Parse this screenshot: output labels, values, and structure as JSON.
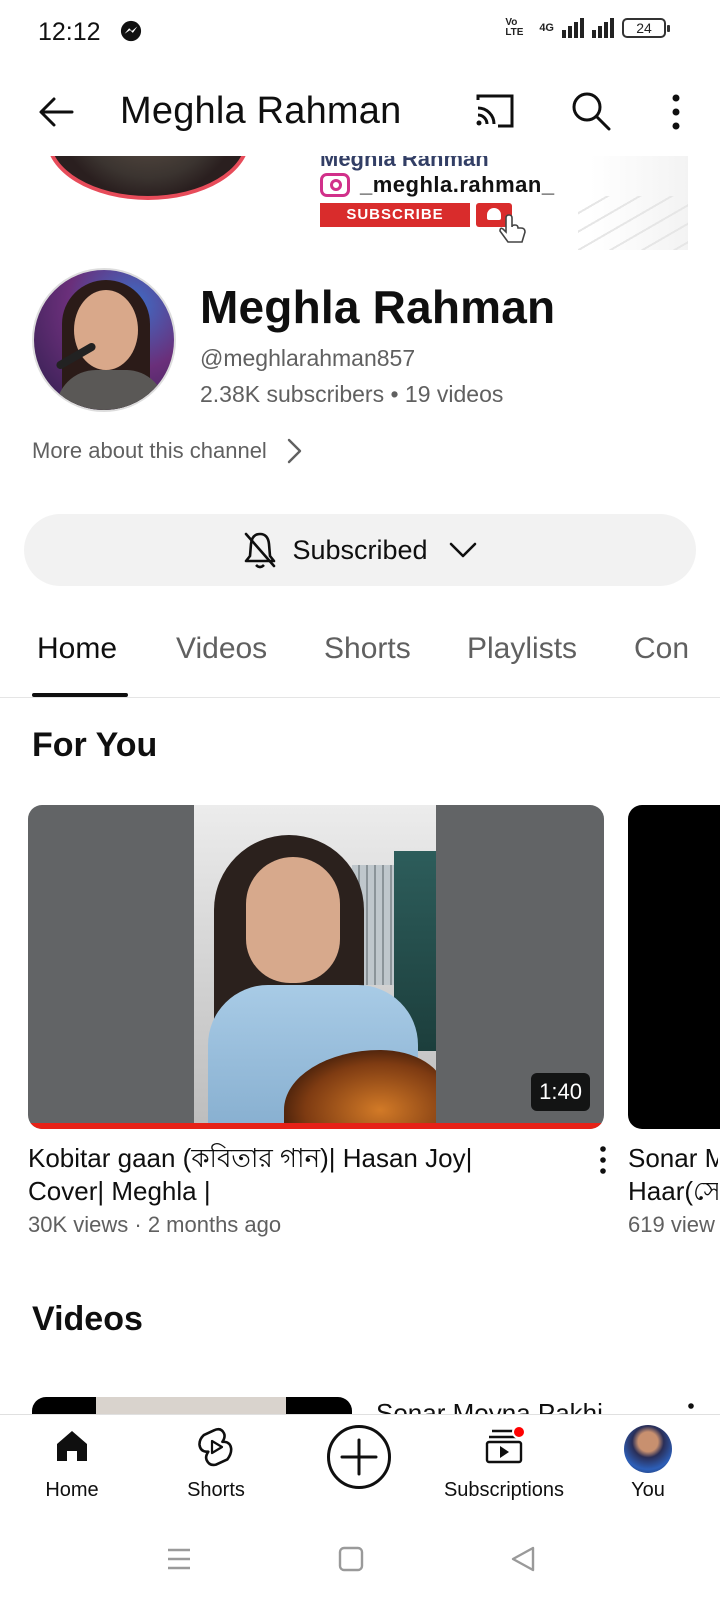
{
  "status_bar": {
    "time": "12:12",
    "network_type": "4G",
    "volte": "Vo LTE",
    "battery": "24"
  },
  "header": {
    "title": "Meghla Rahman"
  },
  "banner": {
    "line1": "Meghla Rahman",
    "instagram_handle": "_meghla.rahman_",
    "subscribe_label": "SUBSCRIBE"
  },
  "channel": {
    "name": "Meghla Rahman",
    "handle": "@meghlarahman857",
    "stats": "2.38K subscribers • 19 videos",
    "more_about": "More about this channel"
  },
  "subscribe_button": {
    "label": "Subscribed"
  },
  "tabs": [
    {
      "label": "Home",
      "active": true
    },
    {
      "label": "Videos",
      "active": false
    },
    {
      "label": "Shorts",
      "active": false
    },
    {
      "label": "Playlists",
      "active": false
    },
    {
      "label": "Con",
      "active": false
    }
  ],
  "for_you": {
    "title": "For You",
    "videos": [
      {
        "title_line1": "Kobitar gaan (কবিতার গান)| Hasan Joy|",
        "title_line2": "Cover| Meghla |",
        "meta": "30K views · 2 months ago",
        "duration": "1:40"
      },
      {
        "title_line1": "Sonar M",
        "title_line2": "Haar(সে",
        "meta": "619 view"
      }
    ]
  },
  "videos_section": {
    "title": "Videos",
    "first_title": "Sonar Moyna Pakhi"
  },
  "bottom_nav": {
    "items": [
      {
        "label": "Home",
        "icon": "home-icon"
      },
      {
        "label": "Shorts",
        "icon": "shorts-icon"
      },
      {
        "label": "",
        "icon": "create-icon"
      },
      {
        "label": "Subscriptions",
        "icon": "subscriptions-icon"
      },
      {
        "label": "You",
        "icon": "avatar"
      }
    ]
  },
  "colors": {
    "accent_red": "#e62117",
    "text_primary": "#0f0f0f",
    "text_secondary": "#606060",
    "chip_bg": "#f2f2f2"
  }
}
